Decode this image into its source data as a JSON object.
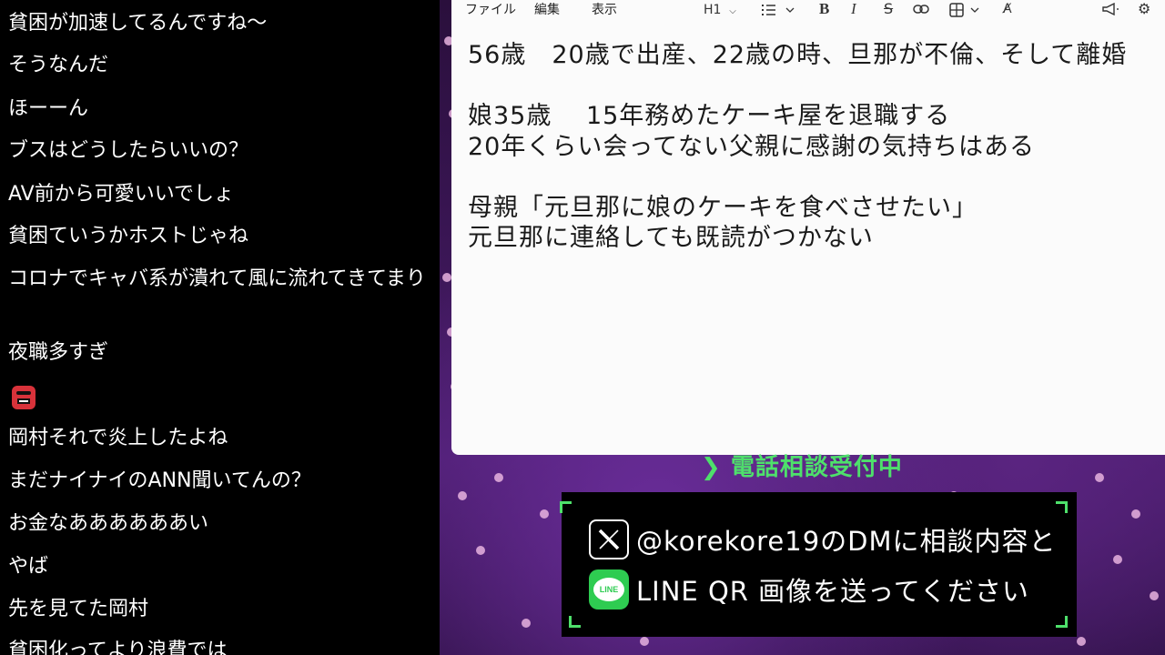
{
  "chat": {
    "messages": [
      "貧困が加速してるんですね～",
      "そうなんだ",
      "ほーーん",
      "ブスはどうしたらいいの？",
      "AV前から可愛いいでしょ",
      "貧困ていうかホストじゃね",
      "コロナでキャバ系が潰れて風に流れてきてまり",
      "夜職多すぎ",
      "",
      "岡村それで炎上したよね",
      "まだナイナイのANN聞いてんの？",
      "お金なああああああい",
      "やば",
      "先を見てた岡村",
      "貧困化ってより浪費では"
    ],
    "emoji_icon": "angry-face-emoji-icon"
  },
  "notepad": {
    "menu": {
      "file": "ファイル",
      "edit": "編集",
      "view": "表示"
    },
    "toolbar": {
      "heading": "H1"
    },
    "lines": [
      "56歳　20歳で出産、22歳の時、旦那が不倫、そして離婚",
      "",
      "娘35歳　 15年務めたケーキ屋を退職する",
      "20年くらい会ってない父親に感謝の気持ちはある",
      "",
      "母親「元旦那に娘のケーキを食べさせたい」",
      "元旦那に連絡しても既読がつかない"
    ]
  },
  "overlay": {
    "banner": "❯ 電話相談受付中",
    "card_line1": "@korekore19のDMに相談内容と",
    "card_line2": "LINE QR 画像を送ってください",
    "line_logo_text": "LINE",
    "accent_color": "#4ee06b"
  }
}
